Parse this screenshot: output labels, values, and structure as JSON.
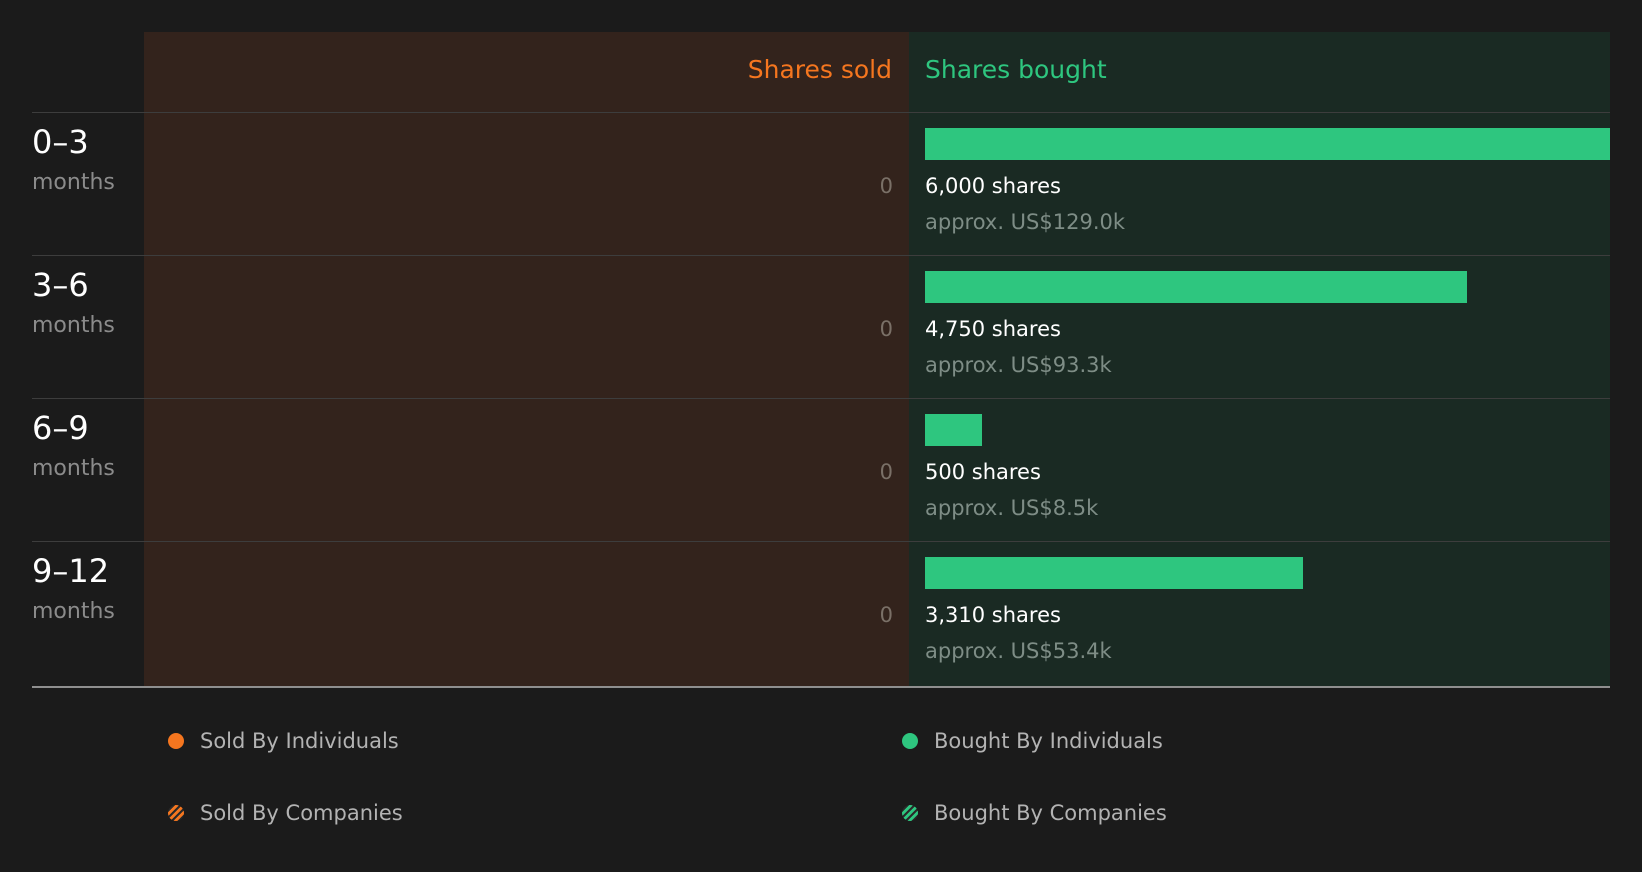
{
  "colors": {
    "sold": "#f5761f",
    "bought": "#2ec67f",
    "sold_panel": "#33231c",
    "bought_panel": "#1a2a23",
    "background": "#1b1b1b"
  },
  "chart_data": {
    "type": "bar",
    "title": "",
    "headers": {
      "sold": "Shares sold",
      "bought": "Shares bought"
    },
    "categories": [
      "0–3",
      "3–6",
      "6–9",
      "9–12"
    ],
    "category_unit": "months",
    "series": [
      {
        "name": "Shares sold",
        "values": [
          0,
          0,
          0,
          0
        ]
      },
      {
        "name": "Shares bought",
        "values": [
          6000,
          4750,
          500,
          3310
        ]
      }
    ],
    "rows": [
      {
        "range": "0–3",
        "unit": "months",
        "sold": 0,
        "sold_label": "0",
        "bought": 6000,
        "bought_label": "6,000 shares",
        "bought_value": "approx. US$129.0k"
      },
      {
        "range": "3–6",
        "unit": "months",
        "sold": 0,
        "sold_label": "0",
        "bought": 4750,
        "bought_label": "4,750 shares",
        "bought_value": "approx. US$93.3k"
      },
      {
        "range": "6–9",
        "unit": "months",
        "sold": 0,
        "sold_label": "0",
        "bought": 500,
        "bought_label": "500 shares",
        "bought_value": "approx. US$8.5k"
      },
      {
        "range": "9–12",
        "unit": "months",
        "sold": 0,
        "sold_label": "0",
        "bought": 3310,
        "bought_label": "3,310 shares",
        "bought_value": "approx. US$53.4k"
      }
    ],
    "bought_max": 6000,
    "legend": [
      {
        "label": "Sold By Individuals",
        "style": "solid",
        "color": "#f5761f"
      },
      {
        "label": "Bought By Individuals",
        "style": "solid",
        "color": "#2ec67f"
      },
      {
        "label": "Sold By Companies",
        "style": "striped",
        "color": "#f5761f"
      },
      {
        "label": "Bought By Companies",
        "style": "striped",
        "color": "#2ec67f"
      }
    ],
    "legend_placement": "bottom"
  }
}
